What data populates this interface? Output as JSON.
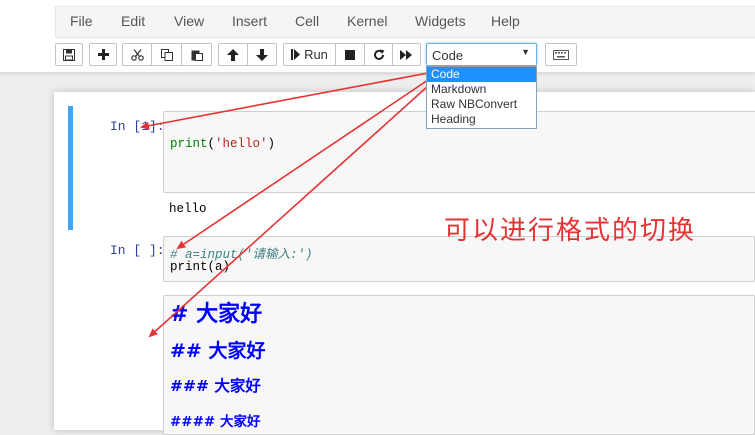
{
  "menubar": {
    "items": [
      "File",
      "Edit",
      "View",
      "Insert",
      "Cell",
      "Kernel",
      "Widgets",
      "Help"
    ]
  },
  "toolbar": {
    "run_label": "Run",
    "cell_type": {
      "selected": "Code",
      "options": [
        "Code",
        "Markdown",
        "Raw NBConvert",
        "Heading"
      ]
    }
  },
  "cells": {
    "cell1": {
      "prompt": "In [1]:",
      "code": {
        "fn": "print",
        "open": "(",
        "string": "'hello'",
        "close": ")"
      },
      "output": "hello"
    },
    "cell2": {
      "prompt": "In [ ]:",
      "comment": "# a=input('请输入:')",
      "line2": "print(a)"
    },
    "cell3": {
      "headings": [
        "# 大家好",
        "## 大家好",
        "### 大家好",
        "#### 大家好"
      ]
    }
  },
  "annotation": "可以进行格式的切换",
  "colors": {
    "accent": "#42a5f5",
    "arrow": "#e63232",
    "prompt": "#303f9f",
    "markdown_heading": "#0000ff"
  }
}
